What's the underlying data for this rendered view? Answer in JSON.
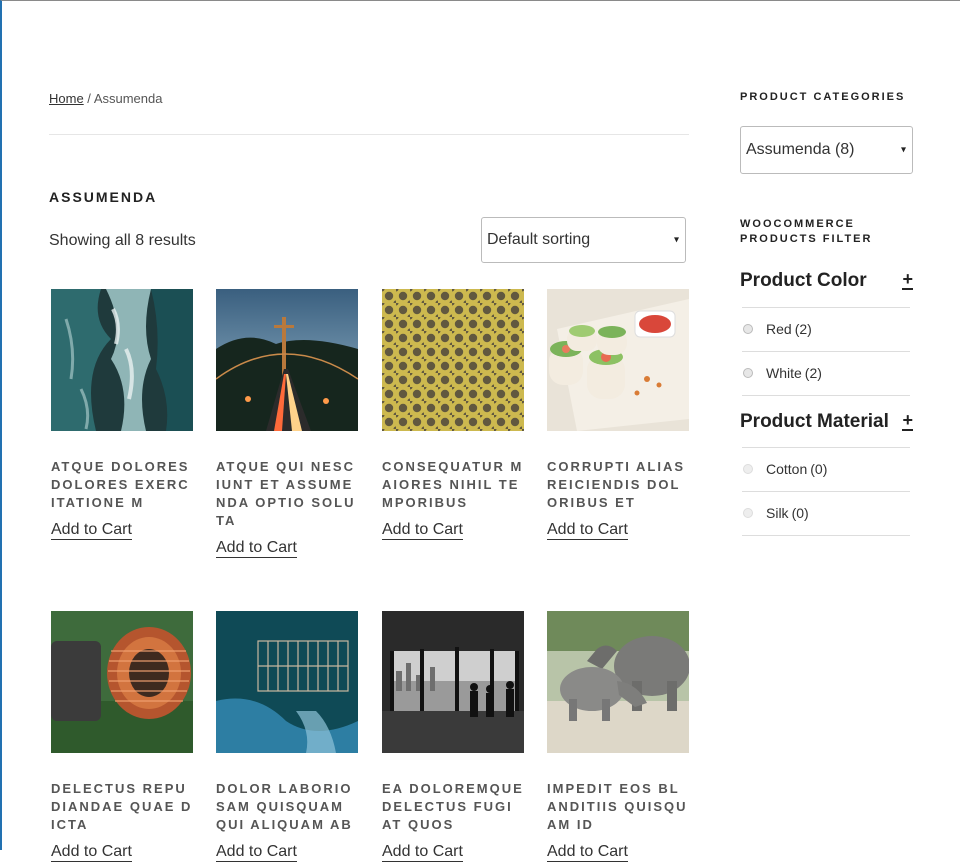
{
  "breadcrumb": {
    "home": "Home",
    "sep": " / ",
    "current": "Assumenda"
  },
  "page_title": "ASSUMENDA",
  "result_count": "Showing all 8 results",
  "sorting": {
    "selected": "Default sorting",
    "caret": "▾"
  },
  "products": [
    {
      "title": "ATQUE DOLORES DOLORES EXERCITATIONE M",
      "cta": "Add to Cart",
      "image": "ocean-waves-aerial"
    },
    {
      "title": "ATQUE QUI NESCIUNT ET ASSUMENDA OPTIO SOLUTA",
      "cta": "Add to Cart",
      "image": "bridge-night-traffic"
    },
    {
      "title": "CONSEQUATUR MAIORES NIHIL TEMPORIBUS",
      "cta": "Add to Cart",
      "image": "yellow-pattern"
    },
    {
      "title": "CORRUPTI ALIAS REICIENDIS DOLORIBUS ET",
      "cta": "Add to Cart",
      "image": "spring-rolls"
    },
    {
      "title": "DELECTUS REPUDIANDAE QUAE DICTA",
      "cta": "Add to Cart",
      "image": "copper-coil"
    },
    {
      "title": "DOLOR LABORIOSAM QUISQUAM QUI ALIQUAM AB",
      "cta": "Add to Cart",
      "image": "wire-basket-blue-wall"
    },
    {
      "title": "EA DOLOREMQUE DELECTUS FUGIAT QUOS",
      "cta": "Add to Cart",
      "image": "city-window-people"
    },
    {
      "title": "IMPEDIT EOS BLANDITIIS QUISQUAM ID",
      "cta": "Add to Cart",
      "image": "rhinos"
    }
  ],
  "sidebar": {
    "categories_title": "PRODUCT CATEGORIES",
    "category_selected": "Assumenda (8)",
    "caret": "▾",
    "filter_title": "WOOCOMMERCE PRODUCTS FILTER",
    "plus": "+",
    "color_title": "Product Color",
    "colors": [
      {
        "label": "Red",
        "count": "(2)"
      },
      {
        "label": "White",
        "count": "(2)"
      }
    ],
    "material_title": "Product Material",
    "materials": [
      {
        "label": "Cotton",
        "count": "(0)"
      },
      {
        "label": "Silk",
        "count": "(0)"
      }
    ]
  },
  "colors": {
    "link_underline": "#333333",
    "title_gray": "#555555",
    "left_accent": "#2271b1"
  }
}
